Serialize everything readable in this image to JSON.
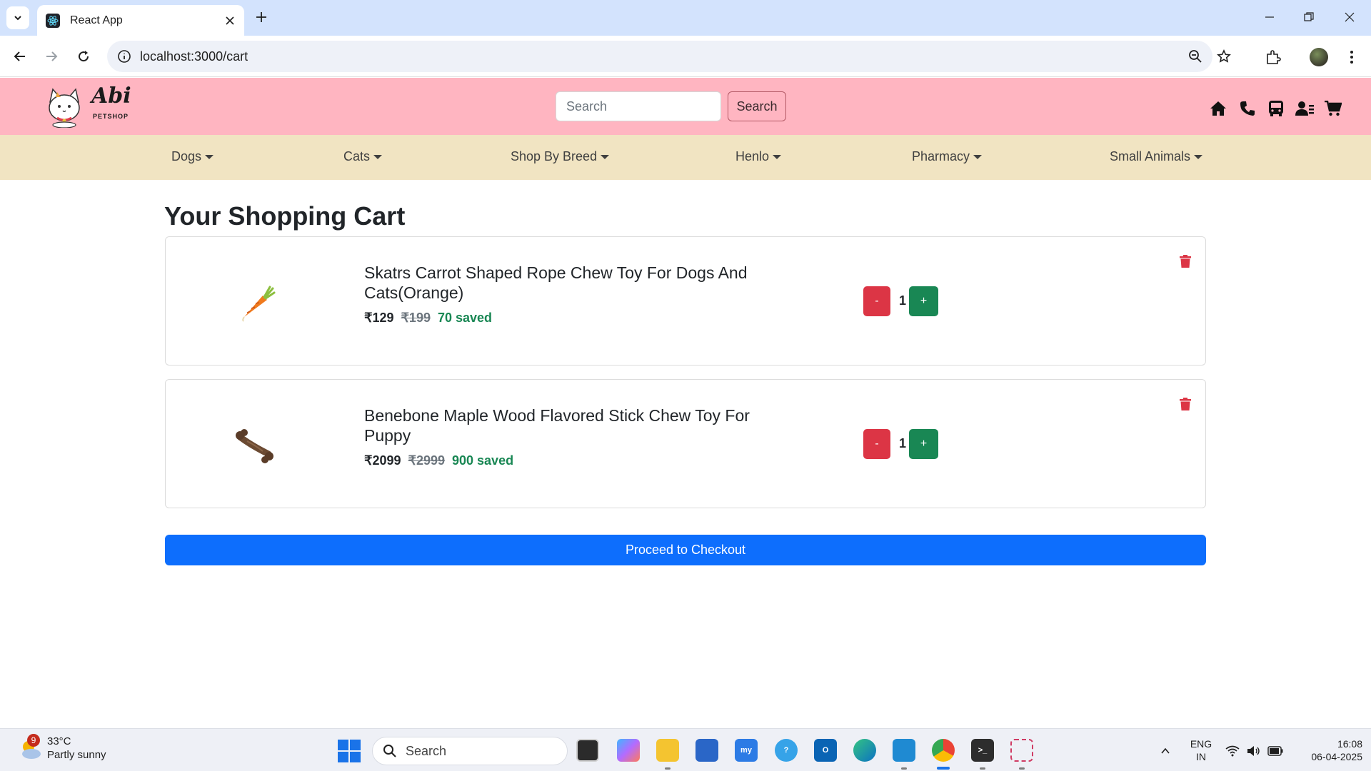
{
  "browser": {
    "tab_title": "React App",
    "url": "localhost:3000/cart"
  },
  "header": {
    "logo_text": "Abi",
    "logo_subtext": "PETSHOP",
    "search_placeholder": "Search",
    "search_button": "Search",
    "icons": [
      "home-icon",
      "phone-icon",
      "bus-icon",
      "user-card-icon",
      "cart-icon"
    ]
  },
  "nav": {
    "items": [
      {
        "label": "Dogs"
      },
      {
        "label": "Cats"
      },
      {
        "label": "Shop By Breed"
      },
      {
        "label": "Henlo"
      },
      {
        "label": "Pharmacy"
      },
      {
        "label": "Small Animals"
      }
    ]
  },
  "cart": {
    "title": "Your Shopping Cart",
    "items": [
      {
        "name": "Skatrs Carrot Shaped Rope Chew Toy For Dogs And Cats(Orange)",
        "price": "₹129",
        "original_price": "₹199",
        "saved": "70 saved",
        "quantity": "1",
        "minus": "-",
        "plus": "+",
        "image": "carrot-toy-image"
      },
      {
        "name": "Benebone Maple Wood Flavored Stick Chew Toy For Puppy",
        "price": "₹2099",
        "original_price": "₹2999",
        "saved": "900 saved",
        "quantity": "1",
        "minus": "-",
        "plus": "+",
        "image": "stick-chew-toy-image"
      }
    ],
    "checkout_label": "Proceed to Checkout"
  },
  "colors": {
    "header_bg": "#ffb5c1",
    "nav_bg": "#f1e4c2",
    "danger": "#dc3545",
    "success": "#198754",
    "primary": "#0d6efd"
  },
  "taskbar": {
    "weather_temp": "33°C",
    "weather_desc": "Partly sunny",
    "weather_badge": "9",
    "search_label": "Search",
    "lang_top": "ENG",
    "lang_bottom": "IN",
    "time": "16:08",
    "date": "06-04-2025"
  }
}
